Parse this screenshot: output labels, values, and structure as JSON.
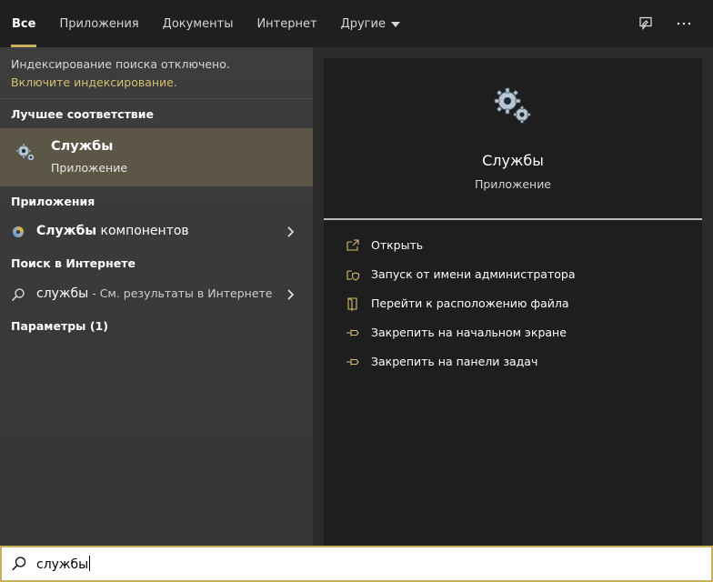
{
  "tabs": [
    {
      "label": "Все",
      "active": true
    },
    {
      "label": "Приложения"
    },
    {
      "label": "Документы"
    },
    {
      "label": "Интернет"
    },
    {
      "label": "Другие"
    }
  ],
  "header_icons": [
    "feedback-icon",
    "more-options-icon"
  ],
  "left": {
    "notice": "Индексирование поиска отключено.",
    "notice_link": "Включите индексирование.",
    "best_match_heading": "Лучшее соответствие",
    "best_match": {
      "title": "Службы",
      "subtitle": "Приложение",
      "icon": "services-gears-icon"
    },
    "apps_heading": "Приложения",
    "app_item": {
      "bold": "Службы",
      "rest": " компонентов",
      "icon": "component-services-icon"
    },
    "web_heading": "Поиск в Интернете",
    "web_item": {
      "query": "службы",
      "suffix": " - См. результаты в Интернете",
      "icon": "search-icon"
    },
    "settings_heading": "Параметры (1)"
  },
  "preview": {
    "title": "Службы",
    "subtitle": "Приложение",
    "actions": [
      {
        "label": "Открыть",
        "icon": "open-icon"
      },
      {
        "label": "Запуск от имени администратора",
        "icon": "run-as-admin-icon"
      },
      {
        "label": "Перейти к расположению файла",
        "icon": "file-location-icon"
      },
      {
        "label": "Закрепить на начальном экране",
        "icon": "pin-start-icon"
      },
      {
        "label": "Закрепить на панели задач",
        "icon": "pin-taskbar-icon"
      }
    ]
  },
  "search": {
    "value": "службы"
  },
  "colors": {
    "accent": "#c7b05c",
    "link": "#d6bf6f",
    "highlight": "#5c5647"
  }
}
